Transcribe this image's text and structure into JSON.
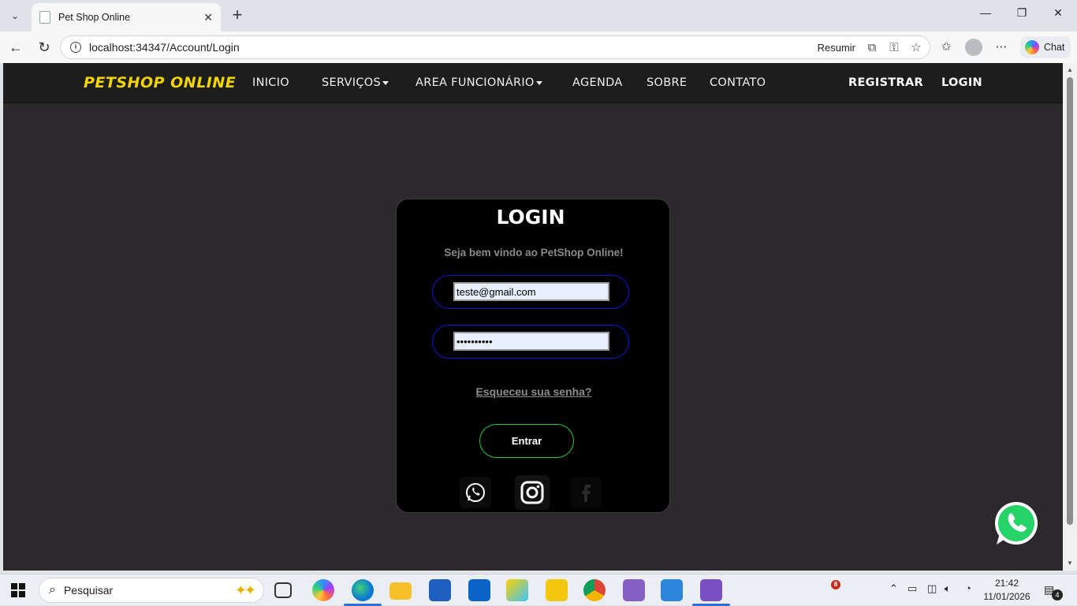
{
  "browser": {
    "tab_title": "Pet Shop Online",
    "tab_close": "✕",
    "new_tab": "+",
    "url": "localhost:34347/Account/Login",
    "resumir_label": "Resumir",
    "chat_label": "Chat",
    "window_minimize": "—",
    "window_restore": "❐",
    "window_close": "✕"
  },
  "site": {
    "brand": "PETSHOP ONLINE",
    "menu": {
      "inicio": "INICIO",
      "servicos": "SERVIÇOS",
      "area_funcionario": "AREA FUNCIONÁRIO",
      "agenda": "AGENDA",
      "sobre": "SOBRE",
      "contato": "CONTATO"
    },
    "registrar": "REGISTRAR",
    "login": "LOGIN"
  },
  "login": {
    "title": "LOGIN",
    "welcome": "Seja bem vindo ao PetShop Online!",
    "email_value": "teste@gmail.com",
    "password_value": "••••••••••",
    "forgot": "Esqueceu sua senha?",
    "submit": "Entrar"
  },
  "taskbar": {
    "search_label": "Pesquisar",
    "time": "21:42",
    "date": "11/01/2026",
    "badge_count": "8",
    "notif_count": "4"
  },
  "colors": {
    "brand_yellow": "#f2d500",
    "field_border": "#0a19d8",
    "button_border": "#1fc93a",
    "page_bg": "#2b292b"
  }
}
